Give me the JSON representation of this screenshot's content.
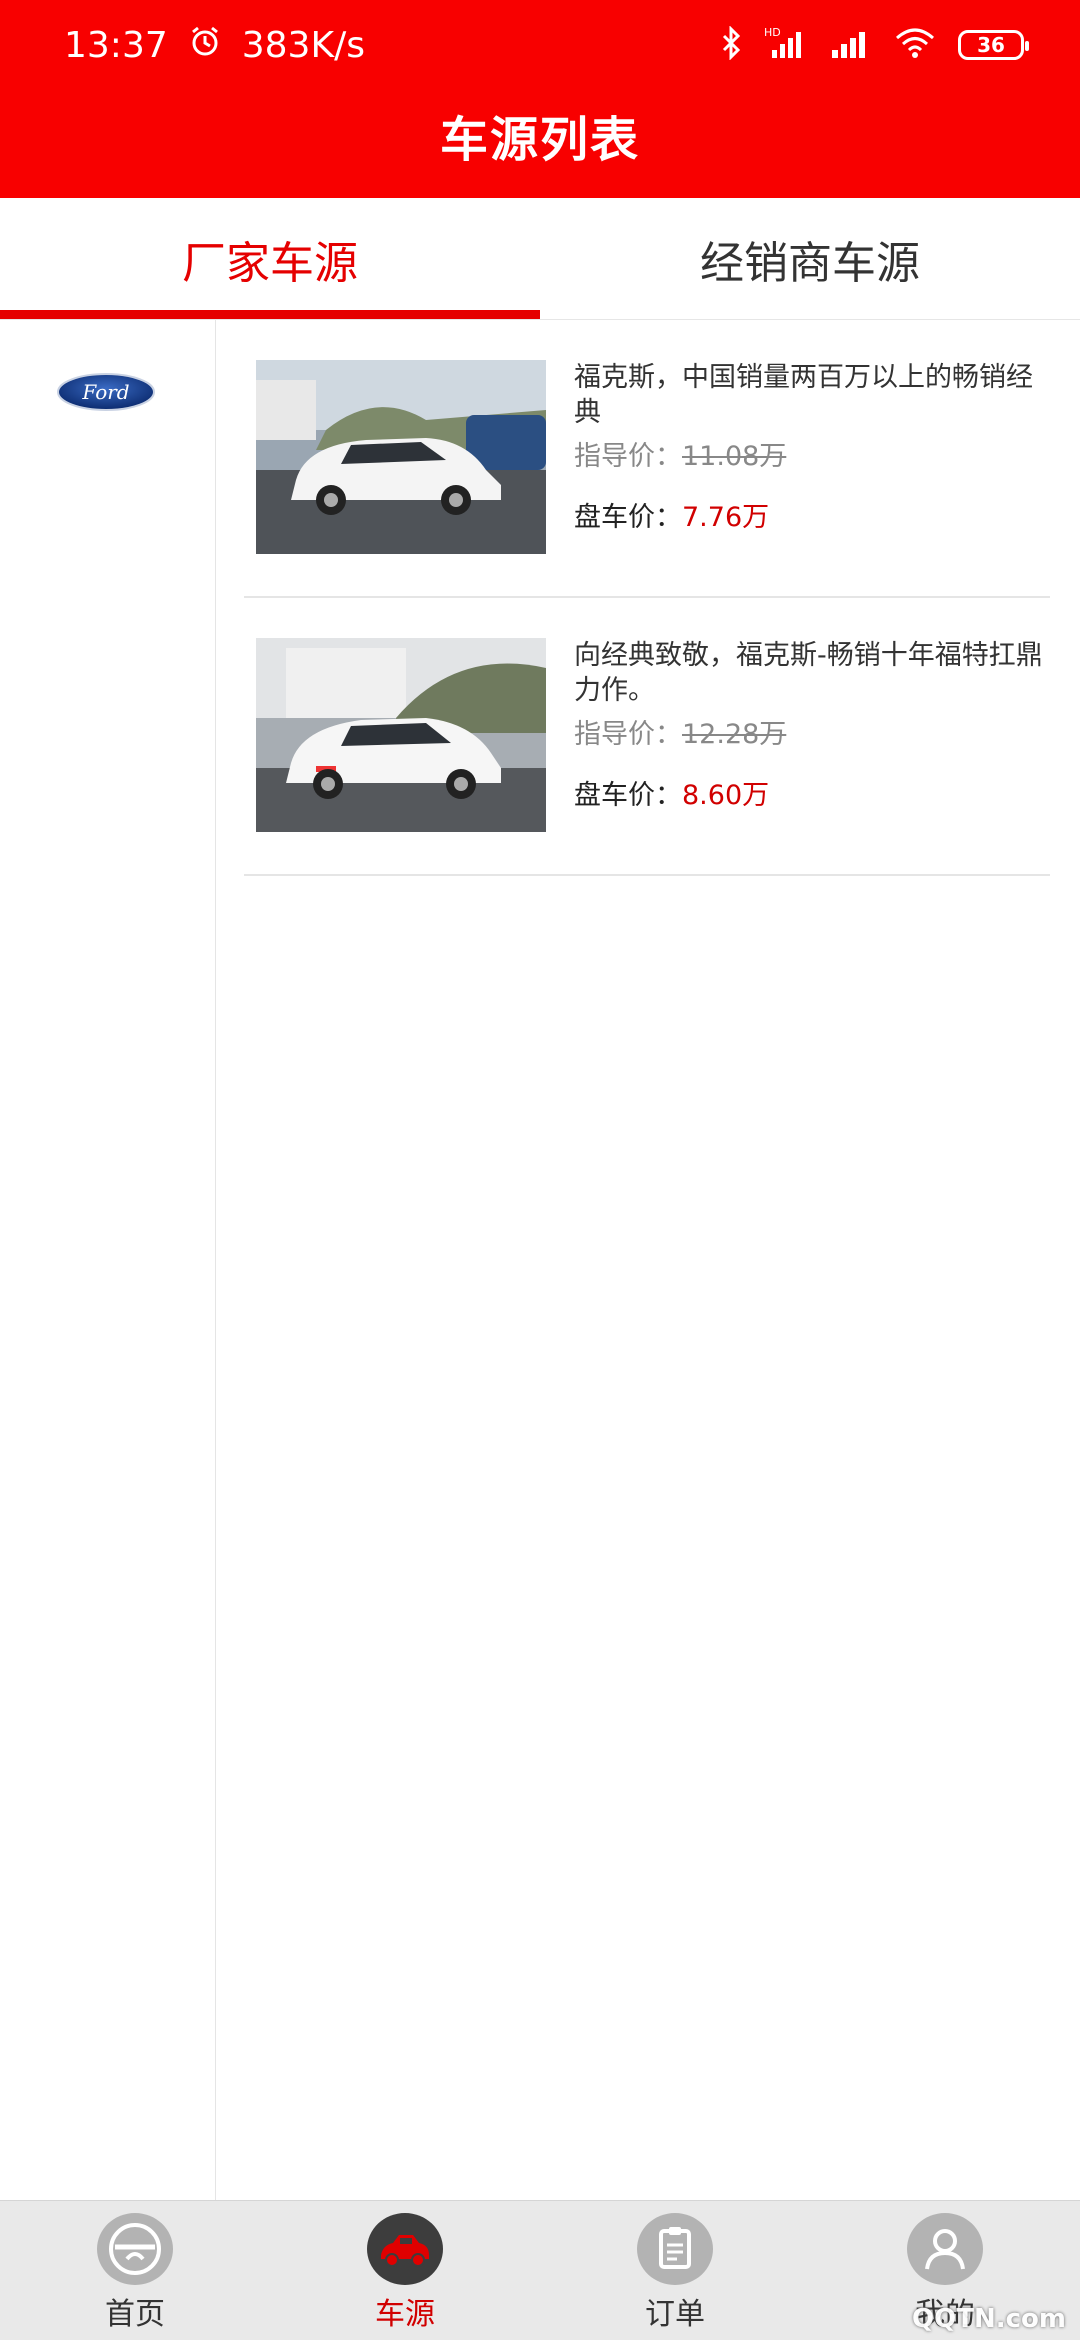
{
  "status_bar": {
    "time": "13:37",
    "speed": "383K/s",
    "battery": "36",
    "icons": [
      "alarm-icon",
      "bluetooth-icon",
      "hd-signal-icon",
      "signal-icon",
      "wifi-icon",
      "battery-icon"
    ]
  },
  "header": {
    "title": "车源列表"
  },
  "tabs": [
    {
      "label": "厂家车源",
      "active": true
    },
    {
      "label": "经销商车源",
      "active": false
    }
  ],
  "brands": [
    {
      "logo_icon": "ford-logo-icon",
      "logo_text": "Ford"
    }
  ],
  "listings": [
    {
      "title": "福克斯，中国销量两百万以上的畅销经典",
      "guide_label": "指导价：",
      "guide_price": "11.08万",
      "pan_label": "盘车价：",
      "pan_price": "7.76万",
      "photo_text": "",
      "image_icon": "car-photo"
    },
    {
      "title": "向经典致敬，福克斯-畅销十年福特扛鼎力作。",
      "guide_label": "指导价：",
      "guide_price": "12.28万",
      "pan_label": "盘车价：",
      "pan_price": "8.60万",
      "photo_text": "",
      "image_icon": "car-photo"
    }
  ],
  "bottom_nav": [
    {
      "label": "首页",
      "icon": "home-icon",
      "active": false
    },
    {
      "label": "车源",
      "icon": "car-icon",
      "active": true
    },
    {
      "label": "订单",
      "icon": "clipboard-icon",
      "active": false
    },
    {
      "label": "我的",
      "icon": "user-icon",
      "active": false
    }
  ],
  "watermark": "QQTN.com",
  "colors": {
    "brand_red": "#f80000",
    "price_red": "#d10000",
    "tab_red": "#e50000"
  }
}
